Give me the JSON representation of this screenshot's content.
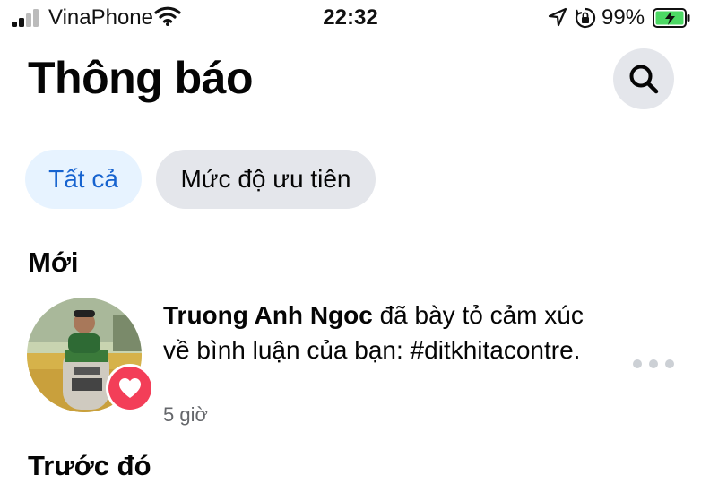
{
  "status_bar": {
    "carrier": "VinaPhone",
    "time": "22:32",
    "battery_percent": "99%",
    "icons": [
      "signal-icon",
      "wifi-icon",
      "location-arrow-icon",
      "rotation-lock-icon",
      "battery-charging-icon"
    ]
  },
  "header": {
    "title": "Thông báo",
    "search_icon": "search-icon"
  },
  "filters": {
    "all_label": "Tất cả",
    "priority_label": "Mức độ ưu tiên",
    "selected": "Tất cả"
  },
  "sections": {
    "new_title": "Mới",
    "previous_title": "Trước đó"
  },
  "notification": {
    "actor": "Truong Anh Ngoc",
    "message": " đã bày tỏ cảm xúc về bình luận của bạn: #ditkhitacontre.",
    "time": "5 giờ",
    "reaction_icon": "heart-icon",
    "more_icon": "more-dots-icon"
  },
  "colors": {
    "accent_blue": "#1763cf",
    "chip_selected_bg": "#e7f3ff",
    "chip_bg": "#e4e6eb",
    "reaction_red": "#f33e58",
    "battery_green": "#4cd964",
    "secondary_text": "#65676b"
  }
}
